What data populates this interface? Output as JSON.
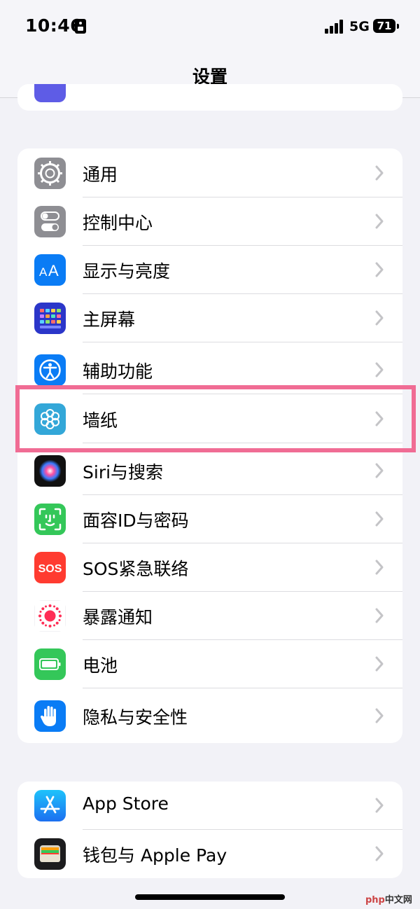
{
  "status_bar": {
    "time": "10:46",
    "network": "5G",
    "battery": "71"
  },
  "nav": {
    "title": "设置"
  },
  "group_main": {
    "items": [
      {
        "label": "通用",
        "icon": "gear-icon"
      },
      {
        "label": "控制中心",
        "icon": "toggles-icon"
      },
      {
        "label": "显示与亮度",
        "icon": "text-size-icon"
      },
      {
        "label": "主屏幕",
        "icon": "app-grid-icon"
      },
      {
        "label": "辅助功能",
        "icon": "accessibility-icon"
      },
      {
        "label": "墙纸",
        "icon": "flower-icon"
      },
      {
        "label": "Siri与搜索",
        "icon": "siri-icon"
      },
      {
        "label": "面容ID与密码",
        "icon": "face-id-icon"
      },
      {
        "label": "SOS紧急联络",
        "icon": "sos-icon",
        "icon_text": "SOS"
      },
      {
        "label": "暴露通知",
        "icon": "exposure-icon"
      },
      {
        "label": "电池",
        "icon": "battery-icon"
      },
      {
        "label": "隐私与安全性",
        "icon": "hand-icon"
      }
    ]
  },
  "group_store": {
    "items": [
      {
        "label": "App Store",
        "icon": "app-store-icon"
      },
      {
        "label": "钱包与 Apple Pay",
        "icon": "wallet-icon"
      }
    ]
  },
  "highlight_target": "墙纸",
  "watermark": {
    "brand": "php",
    "site": "中文网"
  },
  "colors": {
    "highlight": "#f06c94",
    "background": "#f2f2f7"
  }
}
